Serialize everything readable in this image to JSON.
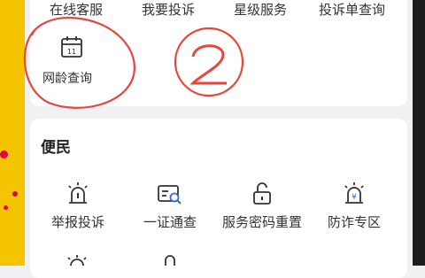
{
  "top_row": {
    "items": [
      {
        "label": "在线客服"
      },
      {
        "label": "我要投诉"
      },
      {
        "label": "星级服务"
      },
      {
        "label": "投诉单查询"
      }
    ]
  },
  "age_tile": {
    "label": "网龄查询",
    "icon": "calendar-icon",
    "calendar_day": "11"
  },
  "convenience": {
    "title": "便民",
    "items": [
      {
        "label": "举报投诉",
        "icon": "alarm-light-icon"
      },
      {
        "label": "一证通查",
        "icon": "id-card-search-icon"
      },
      {
        "label": "服务密码重置",
        "icon": "unlock-icon"
      },
      {
        "label": "防诈专区",
        "icon": "anti-fraud-alarm-icon"
      }
    ]
  },
  "colors": {
    "annotation": "#e8463c",
    "accent": "#1a1a1a",
    "side_left": "#f5c400",
    "dots": "#e6004c"
  }
}
